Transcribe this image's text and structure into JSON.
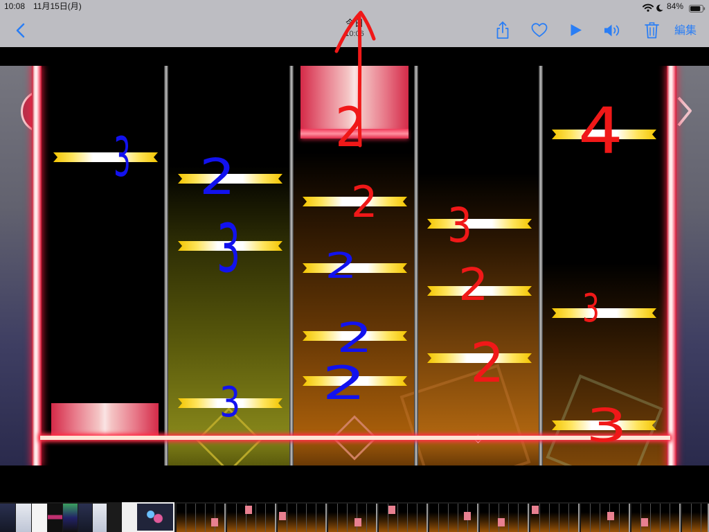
{
  "status_bar": {
    "time": "10:08",
    "date": "11月15日(月)",
    "battery_level": "84%",
    "battery_fill": 0.84,
    "icons": [
      "wifi-icon",
      "moon-icon",
      "battery-icon"
    ]
  },
  "nav": {
    "back_icon": "chevron-left-icon",
    "title": "今日",
    "subtitle": "10:06",
    "action_icons": [
      "share-icon",
      "heart-icon",
      "play-icon",
      "speaker-icon",
      "trash-icon"
    ],
    "edit_label": "編集"
  },
  "colors": {
    "accent": "#2a7ef5",
    "toolbar_bg": "#bdbdc2",
    "annotation_blue": "#1212ee",
    "annotation_red": "#f01818",
    "note_yellow": "#f2c400",
    "judgment_line": "#ff3048"
  },
  "annotations": {
    "blue": [
      "3",
      "2",
      "3",
      "3",
      "2",
      "2",
      "2"
    ],
    "red": [
      "2",
      "2",
      "3",
      "2",
      "2",
      "4",
      "3",
      "3"
    ],
    "arrow_icon": "up-arrow-icon"
  }
}
